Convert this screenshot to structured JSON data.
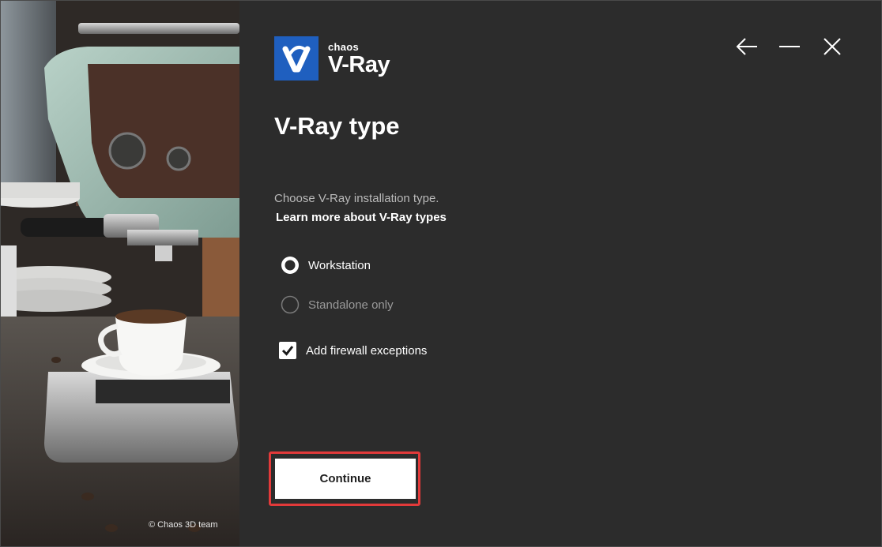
{
  "hero": {
    "credit": "© Chaos 3D team"
  },
  "logo": {
    "brand_small": "chaos",
    "brand_large": "V-Ray"
  },
  "window_controls": {
    "back_icon": "arrow-left-icon",
    "minimize_icon": "minimize-icon",
    "close_icon": "close-icon"
  },
  "page": {
    "title": "V-Ray type",
    "description": "Choose V-Ray installation type.",
    "learn_more": "Learn more about V-Ray types"
  },
  "options": [
    {
      "label": "Workstation",
      "selected": true
    },
    {
      "label": "Standalone only",
      "selected": false
    }
  ],
  "firewall": {
    "label": "Add firewall exceptions",
    "checked": true
  },
  "continue_label": "Continue",
  "colors": {
    "accent": "#1f5fbf",
    "highlight": "#e23a3a",
    "panel_bg": "#2c2c2c"
  }
}
